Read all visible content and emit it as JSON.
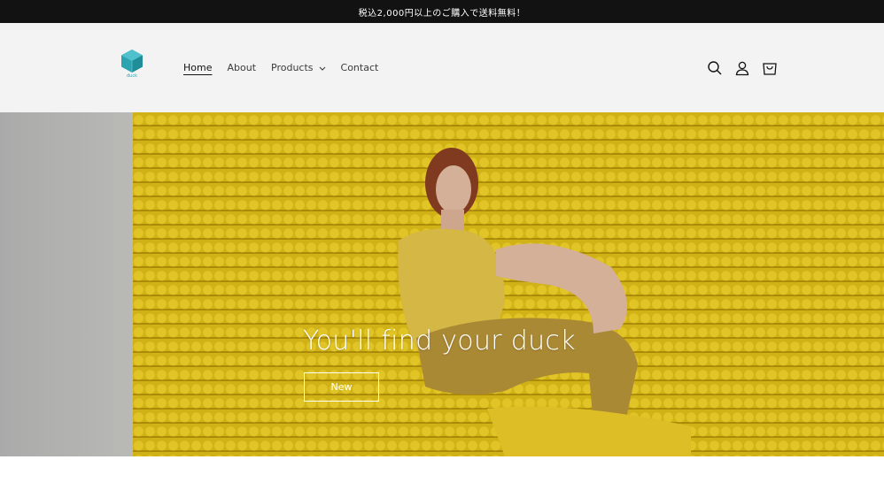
{
  "announcement": {
    "text": "税込2,000円以上のご購入で送料無料！"
  },
  "header": {
    "logo": {
      "text": "duck",
      "color": "#2ba3b1"
    },
    "nav": [
      {
        "label": "Home",
        "active": true
      },
      {
        "label": "About",
        "active": false
      },
      {
        "label": "Products",
        "active": false,
        "has_dropdown": true
      },
      {
        "label": "Contact",
        "active": false
      }
    ],
    "icons": [
      "search-icon",
      "account-icon",
      "cart-icon"
    ]
  },
  "hero": {
    "title": "You'll find your duck",
    "button_label": "New"
  },
  "colors": {
    "announcement_bg": "#121212",
    "header_bg": "#f3f3f3",
    "accent": "#2ba3b1",
    "hero_yellow": "#e2c21a"
  }
}
